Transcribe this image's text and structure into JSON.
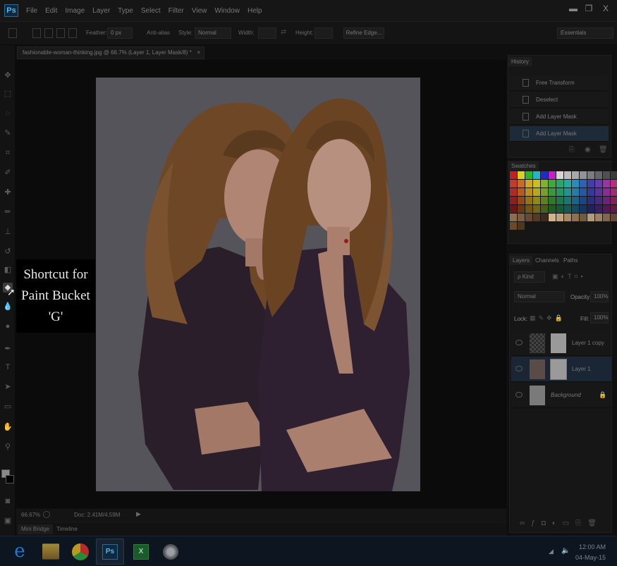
{
  "app": {
    "logo": "Ps",
    "menu": [
      "File",
      "Edit",
      "Image",
      "Layer",
      "Type",
      "Select",
      "Filter",
      "View",
      "Window",
      "Help"
    ],
    "window_controls": [
      "▬",
      "❐",
      "X"
    ]
  },
  "options_bar": {
    "feather_label": "Feather:",
    "feather_value": "0 px",
    "anti_alias_label": "Anti-alias",
    "style_label": "Style:",
    "style_value": "Normal",
    "width_label": "Width:",
    "height_label": "Height:",
    "refine_edge_label": "Refine Edge...",
    "workspace_value": "Essentials"
  },
  "document": {
    "tab_title": "fashionable-woman-thinking.jpg @ 66.7% (Layer 1, Layer Mask/8) *",
    "tab_close": "×"
  },
  "callout": {
    "line1": "Shortcut for",
    "line2": "Paint Bucket",
    "line3": "'G'"
  },
  "status_bar": {
    "zoom": "66.67%",
    "doc_info": "Doc: 2.41M/4.59M"
  },
  "bottom_tabs": [
    "Mini Bridge",
    "Timeline"
  ],
  "history": {
    "tab": "History",
    "items": [
      {
        "label": "Free Transform"
      },
      {
        "label": "Deselect"
      },
      {
        "label": "Add Layer Mask"
      },
      {
        "label": "Add Layer Mask"
      }
    ]
  },
  "swatches": {
    "tab": "Swatches",
    "colors": [
      "#c61f1f",
      "#d8d41c",
      "#2ab52a",
      "#23b7c5",
      "#1b2fc8",
      "#c51cc5",
      "#d5d5d5",
      "#bdbdbd",
      "#a8a8a8",
      "#939393",
      "#7c7c7c",
      "#666666",
      "#505050",
      "#3a3a3a",
      "#c43b2c",
      "#cc6a22",
      "#d1a71f",
      "#c8c01e",
      "#86b22a",
      "#3fa93b",
      "#27a869",
      "#25a7a2",
      "#2290be",
      "#2b63b9",
      "#3e3fae",
      "#683ab0",
      "#9a33aa",
      "#b52f7e",
      "#b02a2a",
      "#b75a1e",
      "#bc8f1c",
      "#b3ab1c",
      "#78a027",
      "#389a36",
      "#229760",
      "#20948f",
      "#1f7fa8",
      "#2658a4",
      "#37389a",
      "#5c339b",
      "#872d96",
      "#a02a70",
      "#8c1f1f",
      "#934718",
      "#967116",
      "#8f8916",
      "#5f801f",
      "#2d7a2b",
      "#1c784c",
      "#1a7672",
      "#1a6486",
      "#1e4583",
      "#2c2d7b",
      "#49297c",
      "#6b2477",
      "#7f2159",
      "#6a1717",
      "#6f3512",
      "#735612",
      "#6d6811",
      "#486118",
      "#225c21",
      "#155a39",
      "#145956",
      "#134b65",
      "#173563",
      "#21225d",
      "#37205e",
      "#501a5a",
      "#601944",
      "#8e6d4e",
      "#7a5c40",
      "#654a33",
      "#513b28",
      "#3d2c1e",
      "#d1b48c",
      "#c2a37a",
      "#a88a62",
      "#8d704d",
      "#725a3d",
      "#b39b7e",
      "#9b8063",
      "#7f664c",
      "#5f4b38",
      "#6b4a2a",
      "#4e361f"
    ]
  },
  "layers_panel": {
    "tabs": [
      "Layers",
      "Channels",
      "Paths"
    ],
    "kind_label": "ρ Kind",
    "blend_mode": "Normal",
    "opacity_label": "Opacity:",
    "opacity_value": "100%",
    "lock_label": "Lock:",
    "fill_label": "Fill:",
    "fill_value": "100%",
    "layers": [
      {
        "name": "Layer 1 copy"
      },
      {
        "name": "Layer 1"
      },
      {
        "name": "Background"
      }
    ]
  },
  "taskbar": {
    "time": "12:00 AM",
    "date": "04-May-15"
  },
  "colors": {
    "accent_blue": "#2d6a92",
    "canvas_bg": "#54545a",
    "callout_bg": "#000000",
    "callout_text": "#e8e8e8"
  }
}
